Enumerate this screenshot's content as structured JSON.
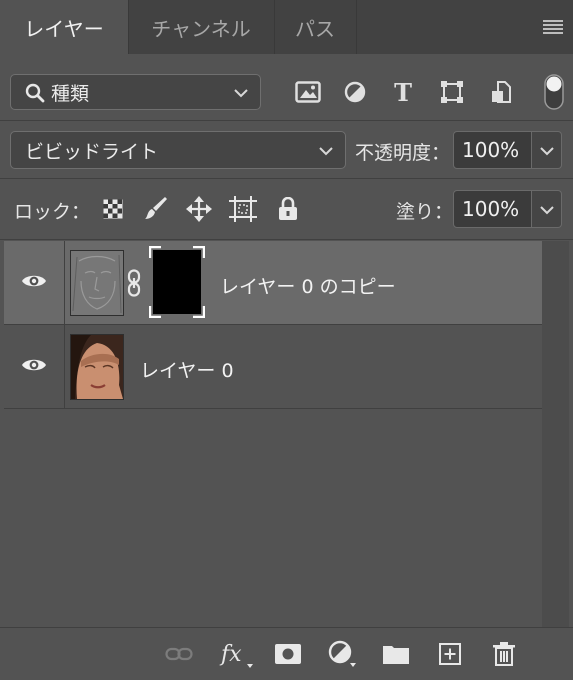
{
  "tabs": [
    {
      "label": "レイヤー",
      "active": true
    },
    {
      "label": "チャンネル",
      "active": false
    },
    {
      "label": "パス",
      "active": false
    }
  ],
  "filter": {
    "kind_label": "種類"
  },
  "blend": {
    "mode": "ビビッドライト",
    "opacity_label": "不透明度：",
    "opacity_value": "100%"
  },
  "lock": {
    "label": "ロック：",
    "fill_label": "塗り：",
    "fill_value": "100%"
  },
  "layers": [
    {
      "name": "レイヤー 0 のコピー",
      "selected": true,
      "visible": true,
      "has_mask": true
    },
    {
      "name": "レイヤー 0",
      "selected": false,
      "visible": true,
      "has_mask": false
    }
  ],
  "bottom_icons": [
    "link-layers-icon",
    "fx-icon",
    "add-mask-icon",
    "adjustment-layer-icon",
    "group-folder-icon",
    "new-layer-icon",
    "trash-icon"
  ],
  "colors": {
    "panel": "#535353",
    "selected_row": "#6a6a6a",
    "tab_bar": "#424242"
  }
}
